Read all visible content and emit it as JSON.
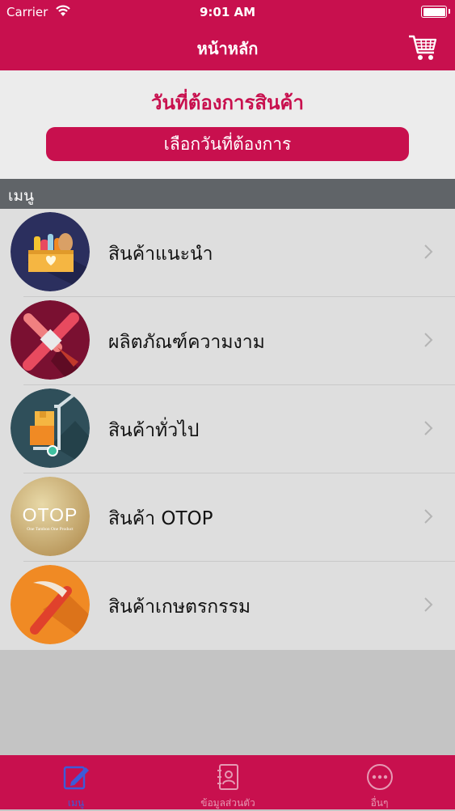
{
  "status": {
    "carrier": "Carrier",
    "time": "9:01 AM"
  },
  "navbar": {
    "title": "หน้าหลัก",
    "cart_icon": "cart-icon"
  },
  "date_section": {
    "heading": "วันที่ต้องการสินค้า",
    "button_label": "เลือกวันที่ต้องการ"
  },
  "menu": {
    "header": "เมนู",
    "items": [
      {
        "label": "สินค้าแนะนำ",
        "icon": "grocery-box-icon"
      },
      {
        "label": "ผลิตภัณฑ์ความงาม",
        "icon": "beauty-brush-icon"
      },
      {
        "label": "สินค้าทั่วไป",
        "icon": "hand-truck-icon"
      },
      {
        "label": "สินค้า OTOP",
        "icon": "otop-logo-icon"
      },
      {
        "label": "สินค้าเกษตรกรรม",
        "icon": "sickle-icon"
      }
    ]
  },
  "otop_logo": {
    "text": "OTOP",
    "tagline": "One Tambon One Product"
  },
  "tabbar": {
    "tabs": [
      {
        "label": "เมนู",
        "icon": "edit-icon",
        "active": true
      },
      {
        "label": "ข้อมูลส่วนตัว",
        "icon": "contact-book-icon",
        "active": false
      },
      {
        "label": "อื่นๆ",
        "icon": "more-icon",
        "active": false
      }
    ]
  },
  "colors": {
    "brand": "#c8104e",
    "active_tab": "#3d5bd9",
    "inactive_tab": "#e699b3"
  }
}
